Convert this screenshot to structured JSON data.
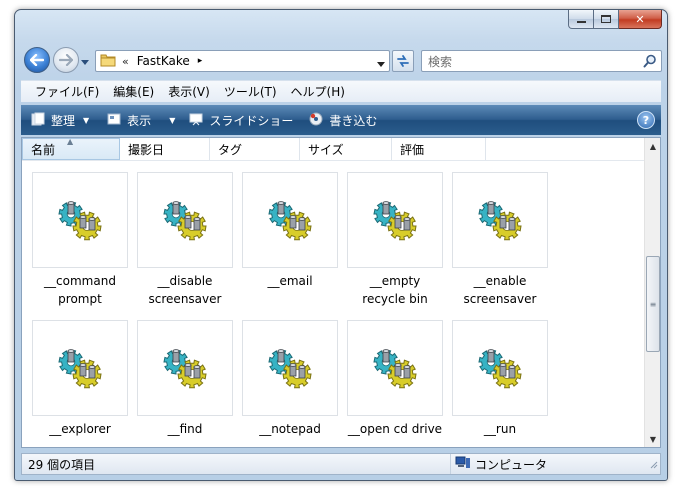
{
  "window": {
    "caption": {
      "minimize": "–",
      "maximize": "□",
      "close": "✕"
    }
  },
  "address": {
    "chevron": "«",
    "segment": "FastKake",
    "separator": "▸",
    "dropdown": "▾"
  },
  "search": {
    "placeholder": "検索"
  },
  "menu": [
    "ファイル(F)",
    "編集(E)",
    "表示(V)",
    "ツール(T)",
    "ヘルプ(H)"
  ],
  "commands": {
    "organize": "整理",
    "views": "表示",
    "slideshow": "スライドショー",
    "burn": "書き込む",
    "help": "?"
  },
  "columns": [
    "名前",
    "撮影日",
    "タグ",
    "サイズ",
    "評価"
  ],
  "items": [
    {
      "label": "__command prompt"
    },
    {
      "label": "__disable screensaver"
    },
    {
      "label": "__email"
    },
    {
      "label": "__empty recycle bin"
    },
    {
      "label": "__enable screensaver"
    },
    {
      "label": "__explorer"
    },
    {
      "label": "__find"
    },
    {
      "label": "__notepad"
    },
    {
      "label": "__open cd drive"
    },
    {
      "label": "__run"
    }
  ],
  "status": {
    "count": "29 個の項目",
    "location": "コンピュータ"
  },
  "colors": {
    "command_bar": "#2e5d8e",
    "close_button": "#c23c22",
    "gear_teal": "#37b3c4",
    "gear_yellow": "#d8cd2a"
  }
}
